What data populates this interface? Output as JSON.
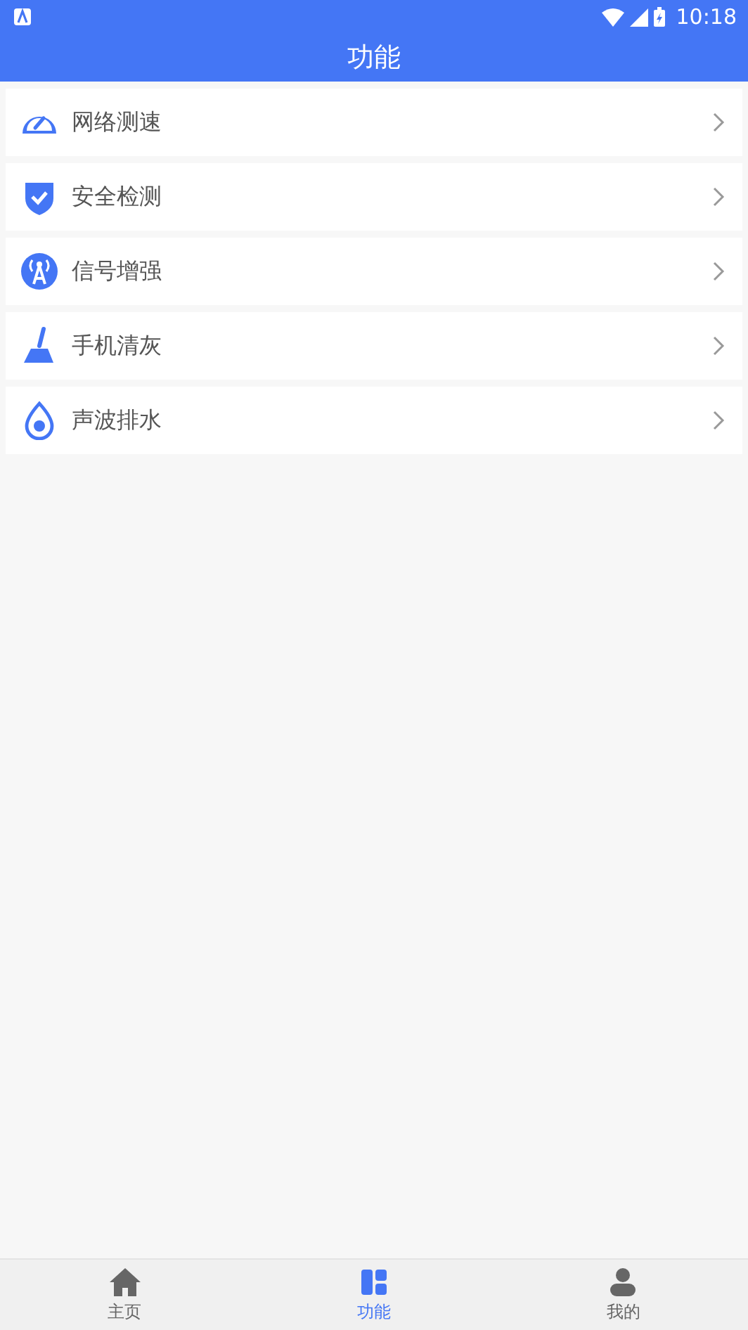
{
  "status_bar": {
    "time": "10:18"
  },
  "header": {
    "title": "功能"
  },
  "items": [
    {
      "kind": "speed",
      "label": "网络测速"
    },
    {
      "kind": "shield",
      "label": "安全检测"
    },
    {
      "kind": "antenna",
      "label": "信号增强"
    },
    {
      "kind": "broom",
      "label": "手机清灰"
    },
    {
      "kind": "drop",
      "label": "声波排水"
    }
  ],
  "tabs": [
    {
      "kind": "home",
      "label": "主页",
      "selected": false
    },
    {
      "kind": "grid",
      "label": "功能",
      "selected": true
    },
    {
      "kind": "person",
      "label": "我的",
      "selected": false
    }
  ]
}
